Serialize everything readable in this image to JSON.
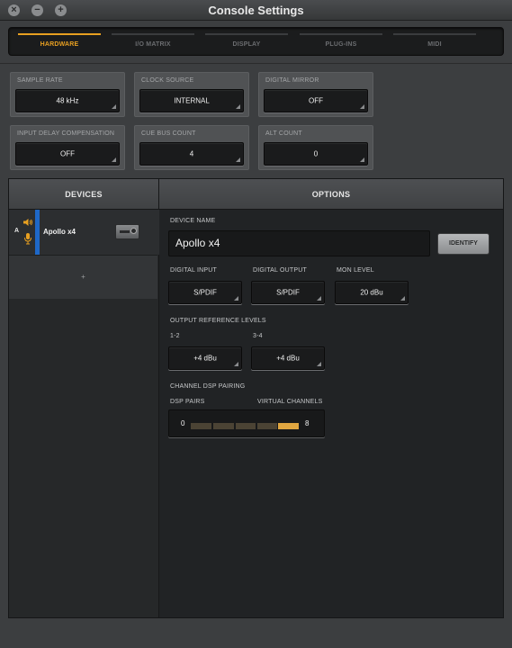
{
  "window": {
    "title": "Console Settings",
    "close_icon": "×",
    "minimize_icon": "−",
    "zoom_icon": "+"
  },
  "tabs": [
    {
      "label": "HARDWARE",
      "active": true
    },
    {
      "label": "I/O MATRIX",
      "active": false
    },
    {
      "label": "DISPLAY",
      "active": false
    },
    {
      "label": "PLUG-INS",
      "active": false
    },
    {
      "label": "MIDI",
      "active": false
    }
  ],
  "settings": {
    "sample_rate": {
      "label": "SAMPLE RATE",
      "value": "48 kHz"
    },
    "clock_source": {
      "label": "CLOCK SOURCE",
      "value": "INTERNAL"
    },
    "digital_mirror": {
      "label": "DIGITAL MIRROR",
      "value": "OFF"
    },
    "input_delay": {
      "label": "INPUT DELAY COMPENSATION",
      "value": "OFF"
    },
    "cue_bus": {
      "label": "CUE BUS COUNT",
      "value": "4"
    },
    "alt_count": {
      "label": "ALT COUNT",
      "value": "0"
    }
  },
  "devices_header": "DEVICES",
  "options_header": "OPTIONS",
  "devices": [
    {
      "letter": "A",
      "name": "Apollo x4"
    }
  ],
  "add_device_label": "+",
  "options": {
    "device_name_label": "DEVICE NAME",
    "device_name_value": "Apollo x4",
    "identify_label": "IDENTIFY",
    "digital_input": {
      "label": "DIGITAL INPUT",
      "value": "S/PDIF"
    },
    "digital_output": {
      "label": "DIGITAL OUTPUT",
      "value": "S/PDIF"
    },
    "mon_level": {
      "label": "MON LEVEL",
      "value": "20 dBu"
    },
    "output_ref_label": "OUTPUT REFERENCE LEVELS",
    "out_1_2": {
      "label": "1-2",
      "value": "+4 dBu"
    },
    "out_3_4": {
      "label": "3-4",
      "value": "+4 dBu"
    },
    "dsp_pairing_label": "CHANNEL DSP PAIRING",
    "dsp_pairs_label": "DSP PAIRS",
    "virtual_channels_label": "VIRTUAL CHANNELS",
    "dsp_min": "0",
    "dsp_max": "8",
    "dsp_level_fraction": 1.0
  },
  "colors": {
    "accent": "#e8a021",
    "device_stripe": "#1e68c8"
  }
}
